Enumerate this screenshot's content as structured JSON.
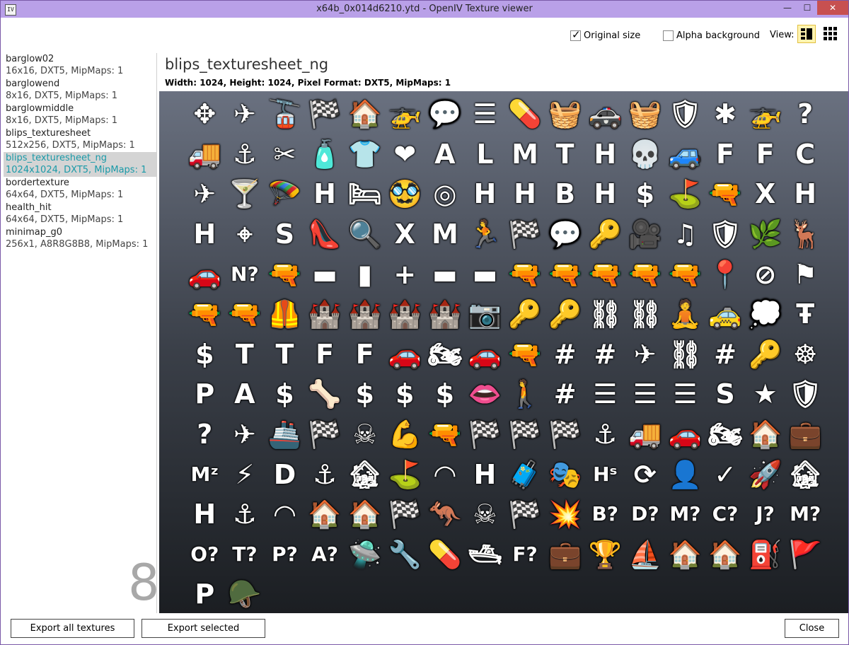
{
  "window": {
    "title": "x64b_0x014d6210.ytd - OpenIV Texture viewer",
    "app_icon": "IV",
    "minimize": "—",
    "maximize": "☐",
    "close": "✕"
  },
  "toolbar": {
    "original_size_label": "Original size",
    "original_size_checked": true,
    "alpha_background_label": "Alpha background",
    "alpha_background_checked": false,
    "view_label": "View:"
  },
  "textures": [
    {
      "name": "barglow02",
      "info": "16x16, DXT5, MipMaps: 1"
    },
    {
      "name": "barglowend",
      "info": "8x16, DXT5, MipMaps: 1"
    },
    {
      "name": "barglowmiddle",
      "info": "8x16, DXT5, MipMaps: 1"
    },
    {
      "name": "blips_texturesheet",
      "info": "512x256, DXT5, MipMaps: 1"
    },
    {
      "name": "blips_texturesheet_ng",
      "info": "1024x1024, DXT5, MipMaps: 1"
    },
    {
      "name": "bordertexture",
      "info": "64x64, DXT5, MipMaps: 1"
    },
    {
      "name": "health_hit",
      "info": "64x64, DXT5, MipMaps: 1"
    },
    {
      "name": "minimap_g0",
      "info": "256x1, A8R8G8B8, MipMaps: 1"
    }
  ],
  "sidebar": {
    "count": "8"
  },
  "main": {
    "title": "blips_texturesheet_ng",
    "properties": "Width: 1024, Height: 1024, Pixel Format: DXT5, MipMaps: 1"
  },
  "bottom": {
    "export_all": "Export all textures",
    "export_selected": "Export selected",
    "close": "Close"
  },
  "icons": [
    "✥",
    "✈",
    "🚡",
    "🏁",
    "🏠",
    "🚁",
    "💬",
    "☰",
    "💊",
    "🧺",
    "🚓",
    "🧺",
    "🛡",
    "✱",
    "🚁",
    "?",
    "🚚",
    "⚓",
    "✂",
    "🧴",
    "👕",
    "❤",
    "A",
    "L",
    "M",
    "T",
    "H",
    "💀",
    "🚙",
    "F",
    "F",
    "C",
    "✈",
    "🍸",
    "🪂",
    "H",
    "🛏",
    "🥸",
    "◎",
    "H",
    "H",
    "B",
    "H",
    "$",
    "⛳",
    "🔫",
    "X",
    "H",
    "H",
    "⌖",
    "S",
    "👠",
    "🔍",
    "X",
    "M",
    "🏃",
    "🏁",
    "💬",
    "🔑",
    "🎥",
    "♫",
    "🛡",
    "🌿",
    "🦌",
    "🚗",
    "N?",
    "🔫",
    "▬",
    "▮",
    "+",
    "▬",
    "▬",
    "🔫",
    "🔫",
    "🔫",
    "🔫",
    "🔫",
    "📍",
    "⊘",
    "⚑",
    "🔫",
    "🔫",
    "🦺",
    "🏰",
    "🏰",
    "🏰",
    "🏰",
    "📷",
    "🔑",
    "🔑",
    "⛓",
    "⛓",
    "🧘",
    "🚕",
    "💭",
    "Ŧ",
    "$",
    "T",
    "T",
    "F",
    "F",
    "🚗",
    "🏍",
    "🚗",
    "🔫",
    "#",
    "#",
    "✈",
    "⛓",
    "#",
    "🔑",
    "☸",
    "P",
    "A",
    "$",
    "🦴",
    "$",
    "$",
    "$",
    "👄",
    "🚶",
    "#",
    "☰",
    "☰",
    "☰",
    "S",
    "★",
    "🛡",
    "?",
    "✈",
    "🚢",
    "🏁",
    "☠",
    "💪",
    "🔫",
    "🏁",
    "🏁",
    "🏁",
    "⚓",
    "🚚",
    "🚗",
    "🏍",
    "🏠",
    "💼",
    "Mᶻ",
    "⚡",
    "D",
    "⚓",
    "🏚",
    "⛳",
    "◠",
    "H",
    "🧳",
    "🎭",
    "Hˢ",
    "⟳",
    "👤",
    "✓",
    "🚀",
    "🏚",
    "H",
    "⚓",
    "◠",
    "🏠",
    "🏠",
    "🏁",
    "🦘",
    "☠",
    "🏁",
    "💥",
    "B?",
    "D?",
    "M?",
    "C?",
    "J?",
    "M?",
    "O?",
    "T?",
    "P?",
    "A?",
    "🛸",
    "🔧",
    "💊",
    "🛥",
    "F?",
    "💼",
    "🏆",
    "⛵",
    "🏠",
    "🏠",
    "⛽",
    "🚩",
    "P",
    "🪖"
  ]
}
